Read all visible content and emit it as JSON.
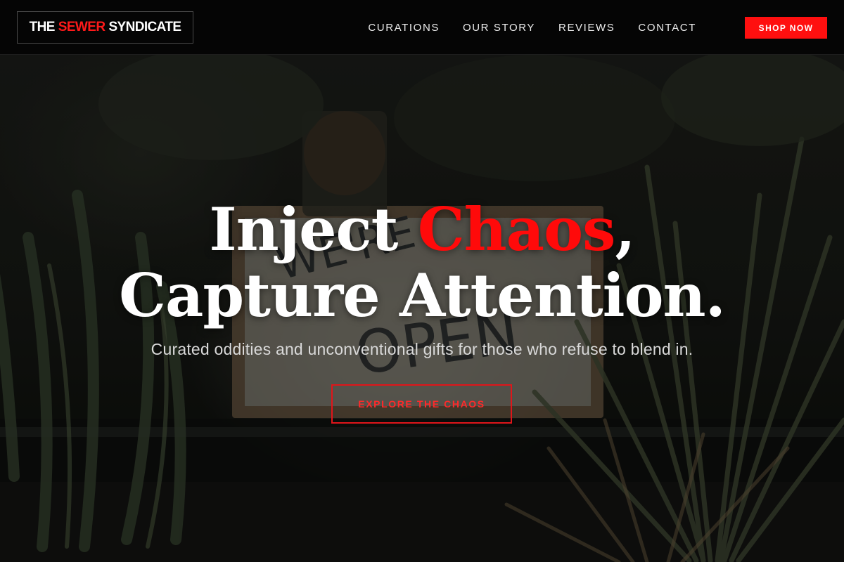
{
  "header": {
    "logo": {
      "part1": "THE",
      "part2": "SEWER",
      "part3": "SYNDICATE"
    },
    "nav": [
      {
        "label": "CURATIONS"
      },
      {
        "label": "OUR STORY"
      },
      {
        "label": "REVIEWS"
      },
      {
        "label": "CONTACT"
      }
    ],
    "cta_label": "SHOP NOW"
  },
  "hero": {
    "title": {
      "word1": "Inject",
      "accent": "Chaos",
      "comma": ",",
      "line2": "Capture Attention."
    },
    "subtitle": "Curated oddities and unconventional gifts for those who refuse to blend in.",
    "button_label": "EXPLORE THE CHAOS",
    "background_image": "dim photo of a shop window with potted plants and a 'WE'RE OPEN' sign"
  },
  "colors": {
    "accent": "#ff0a0a",
    "background": "#050505",
    "text": "#ffffff"
  }
}
